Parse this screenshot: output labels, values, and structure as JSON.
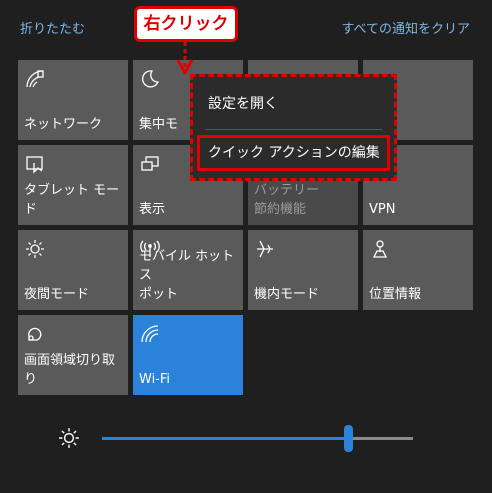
{
  "header": {
    "collapse_label": "折りたたむ",
    "clear_all_label": "すべての通知をクリア"
  },
  "tiles": {
    "network": "ネットワーク",
    "focus": "集中モ",
    "tablet": "タブレット モード",
    "display": "表示",
    "battery_saver": "バッテリー\n節約機能",
    "vpn": "VPN",
    "night_light": "夜間モード",
    "mobile_hotspot": "モバイル ホットス\nポット",
    "airplane": "機内モード",
    "location": "位置情報",
    "screen_snip": "画面領域切り取\nり",
    "wifi": "Wi-Fi"
  },
  "context_menu": {
    "open_settings": "設定を開く",
    "edit_quick_actions": "クイック アクションの編集"
  },
  "annotation": {
    "callout": "右クリック"
  },
  "brightness": {
    "level": 0.79
  },
  "colors": {
    "accent": "#2a82da",
    "annotation_red": "#e00000",
    "tile": "#5a5a5a",
    "link": "#7fb6e8"
  }
}
